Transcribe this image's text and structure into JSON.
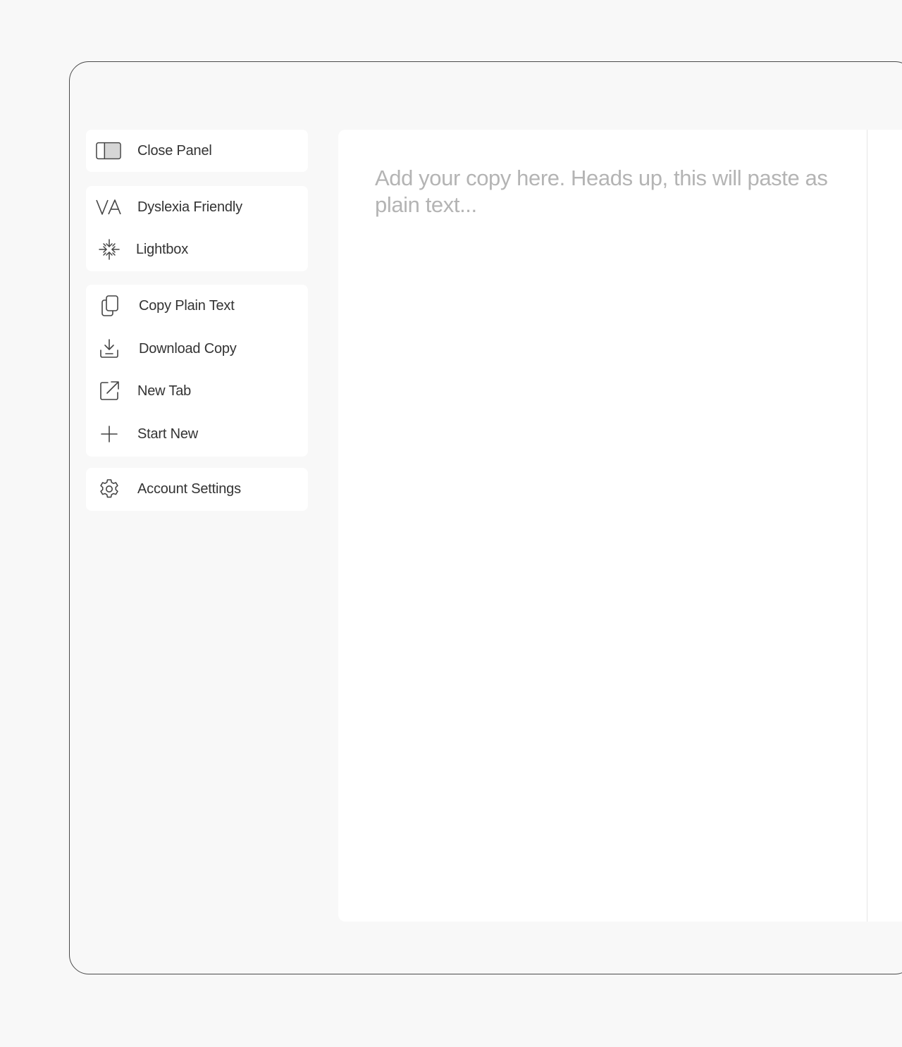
{
  "sidebar": {
    "close_panel": {
      "label": "Close Panel",
      "icon": "panel-icon"
    },
    "view_group": [
      {
        "label": "Dyslexia Friendly",
        "icon": "dyslexia-icon"
      },
      {
        "label": "Lightbox",
        "icon": "lightbox-icon"
      }
    ],
    "action_group": [
      {
        "label": "Copy Plain Text",
        "icon": "copy-icon"
      },
      {
        "label": "Download Copy",
        "icon": "download-icon"
      },
      {
        "label": "New Tab",
        "icon": "external-link-icon"
      },
      {
        "label": "Start New",
        "icon": "plus-icon"
      }
    ],
    "account_settings": {
      "label": "Account Settings",
      "icon": "gear-icon"
    }
  },
  "editor": {
    "placeholder": "Add your copy here. Heads up, this will paste as plain text..."
  },
  "colors": {
    "background": "#f8f8f8",
    "panel": "#ffffff",
    "text": "#333333",
    "placeholder": "#b4b4b4",
    "frame_border": "#4a4a4a"
  }
}
